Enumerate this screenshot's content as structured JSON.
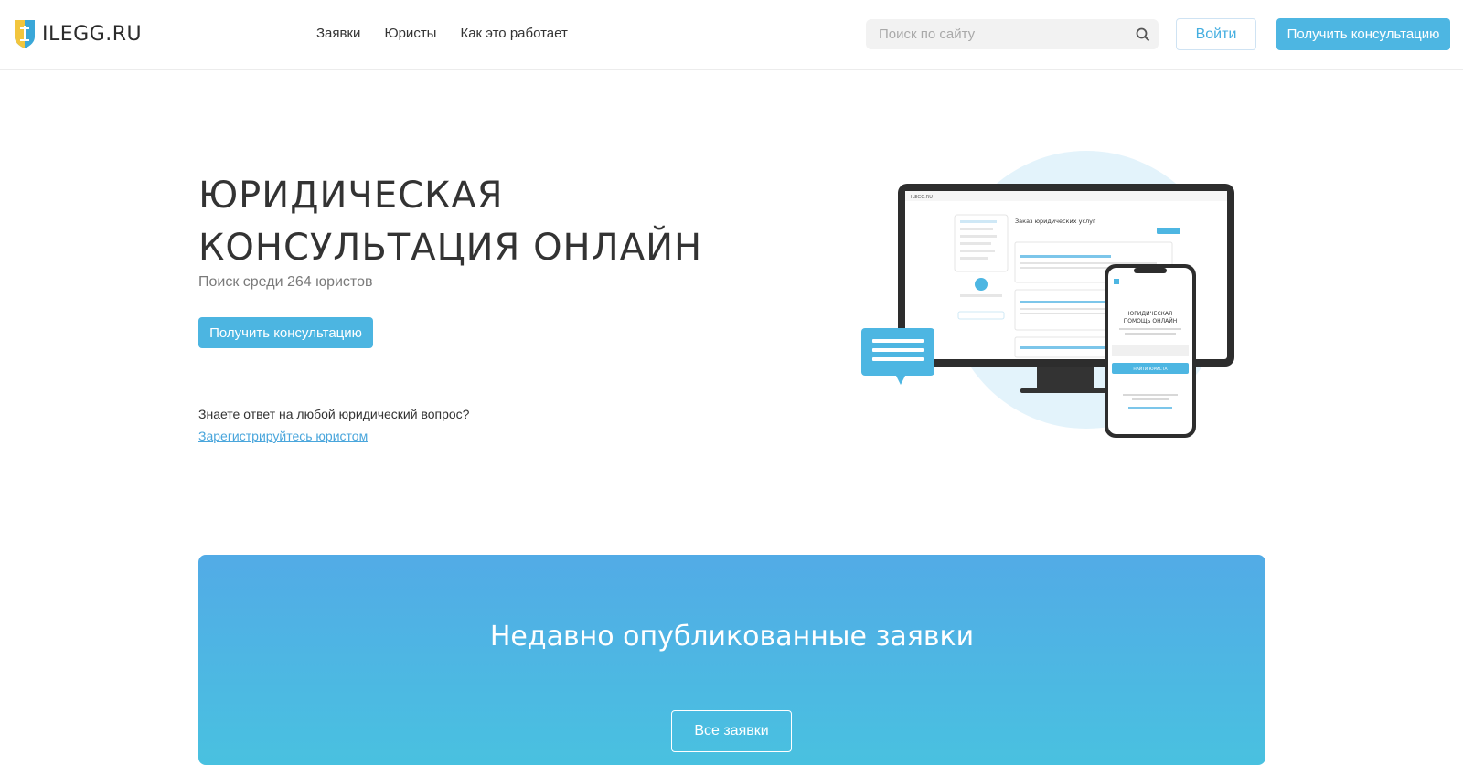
{
  "header": {
    "logo_text": "ILEGG.RU",
    "nav": [
      "Заявки",
      "Юристы",
      "Как это работает"
    ],
    "search_placeholder": "Поиск по сайту",
    "login_label": "Войти",
    "consult_label": "Получить консультацию"
  },
  "hero": {
    "title_line1": "ЮРИДИЧЕСКАЯ",
    "title_line2": "КОНСУЛЬТАЦИЯ ОНЛАЙН",
    "subtitle": "Поиск среди 264 юристов",
    "cta_label": "Получить консультацию",
    "question": "Знаете ответ на любой юридический вопрос?",
    "register_link": "Зарегистрируйтесь юристом"
  },
  "illustration": {
    "monitor_logo": "ILEGG.RU",
    "monitor_heading": "Заказ юридических услуг",
    "phone_heading_line1": "ЮРИДИЧЕСКАЯ",
    "phone_heading_line2": "ПОМОЩЬ ОНЛАЙН",
    "phone_button": "НАЙТИ ЮРИСТА"
  },
  "recent": {
    "title": "Недавно опубликованные заявки",
    "all_label": "Все заявки"
  },
  "colors": {
    "accent": "#4db6e2",
    "banner_top": "#52abe6",
    "banner_bottom": "#49c1e0",
    "link": "#4aa6dc"
  }
}
